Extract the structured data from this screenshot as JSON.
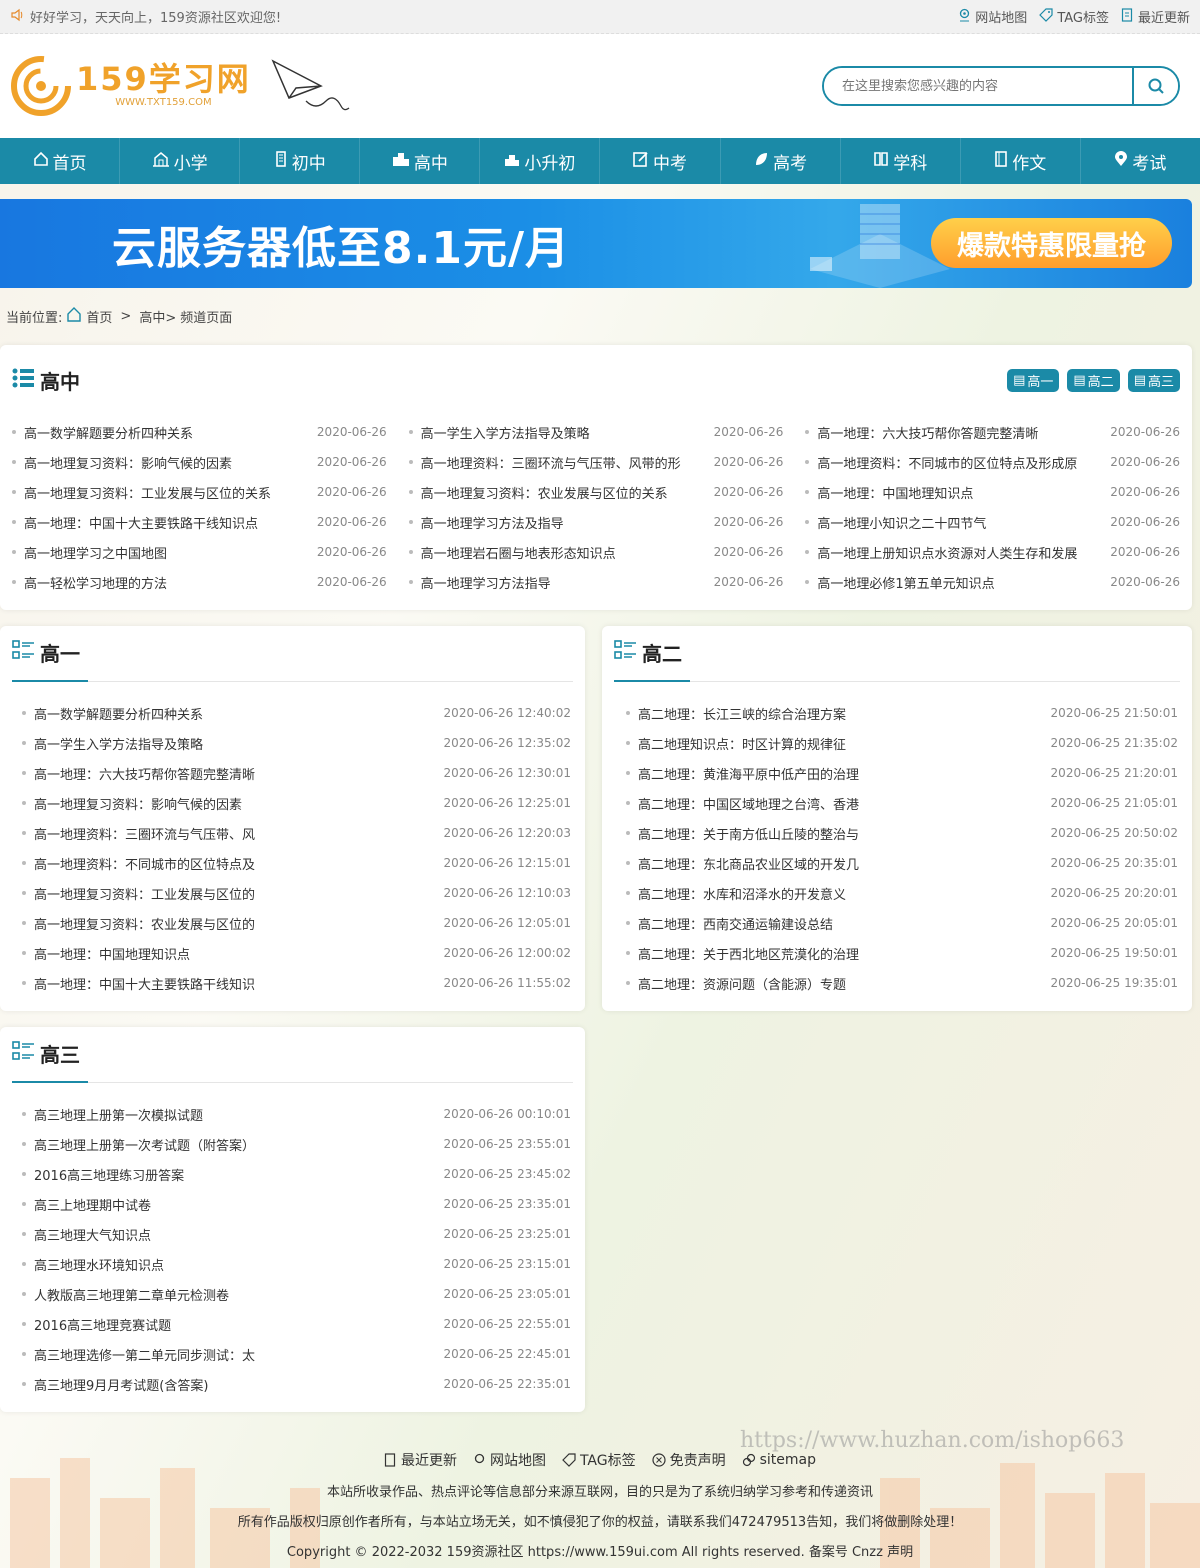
{
  "topbar": {
    "welcome": "好好学习，天天向上，159资源社区欢迎您!",
    "links": [
      "网站地图",
      "TAG标签",
      "最近更新"
    ]
  },
  "header": {
    "logo_title": "159学习网",
    "logo_url": "WWW.TXT159.COM",
    "search_placeholder": "在这里搜索您感兴趣的内容"
  },
  "nav": [
    "首页",
    "小学",
    "初中",
    "高中",
    "小升初",
    "中考",
    "高考",
    "学科",
    "作文",
    "考试"
  ],
  "banner": {
    "title": "云服务器低至8.1元/月",
    "button": "爆款特惠限量抢"
  },
  "breadcrumb": {
    "prefix": "当前位置:",
    "home": "首页",
    "sep": ">",
    "current": "高中>",
    "page": "频道页面"
  },
  "main_card": {
    "title": "高中",
    "tabs": [
      "高一",
      "高二",
      "高三"
    ],
    "columns": [
      [
        {
          "title": "高一数学解题要分析四种关系",
          "date": "2020-06-26"
        },
        {
          "title": "高一地理复习资料：影响气候的因素",
          "date": "2020-06-26"
        },
        {
          "title": "高一地理复习资料：工业发展与区位的关系",
          "date": "2020-06-26"
        },
        {
          "title": "高一地理：中国十大主要铁路干线知识点",
          "date": "2020-06-26"
        },
        {
          "title": "高一地理学习之中国地图",
          "date": "2020-06-26"
        },
        {
          "title": "高一轻松学习地理的方法",
          "date": "2020-06-26"
        }
      ],
      [
        {
          "title": "高一学生入学方法指导及策略",
          "date": "2020-06-26"
        },
        {
          "title": "高一地理资料：三圈环流与气压带、风带的形",
          "date": "2020-06-26"
        },
        {
          "title": "高一地理复习资料：农业发展与区位的关系",
          "date": "2020-06-26"
        },
        {
          "title": "高一地理学习方法及指导",
          "date": "2020-06-26"
        },
        {
          "title": "高一地理岩石圈与地表形态知识点",
          "date": "2020-06-26"
        },
        {
          "title": "高一地理学习方法指导",
          "date": "2020-06-26"
        }
      ],
      [
        {
          "title": "高一地理：六大技巧帮你答题完整清晰",
          "date": "2020-06-26"
        },
        {
          "title": "高一地理资料：不同城市的区位特点及形成原",
          "date": "2020-06-26"
        },
        {
          "title": "高一地理：中国地理知识点",
          "date": "2020-06-26"
        },
        {
          "title": "高一地理小知识之二十四节气",
          "date": "2020-06-26"
        },
        {
          "title": "高一地理上册知识点水资源对人类生存和发展",
          "date": "2020-06-26"
        },
        {
          "title": "高一地理必修1第五单元知识点",
          "date": "2020-06-26"
        }
      ]
    ]
  },
  "gaoyi": {
    "title": "高一",
    "items": [
      {
        "title": "高一数学解题要分析四种关系",
        "date": "2020-06-26 12:40:02"
      },
      {
        "title": "高一学生入学方法指导及策略",
        "date": "2020-06-26 12:35:02"
      },
      {
        "title": "高一地理：六大技巧帮你答题完整清晰",
        "date": "2020-06-26 12:30:01"
      },
      {
        "title": "高一地理复习资料：影响气候的因素",
        "date": "2020-06-26 12:25:01"
      },
      {
        "title": "高一地理资料：三圈环流与气压带、风",
        "date": "2020-06-26 12:20:03"
      },
      {
        "title": "高一地理资料：不同城市的区位特点及",
        "date": "2020-06-26 12:15:01"
      },
      {
        "title": "高一地理复习资料：工业发展与区位的",
        "date": "2020-06-26 12:10:03"
      },
      {
        "title": "高一地理复习资料：农业发展与区位的",
        "date": "2020-06-26 12:05:01"
      },
      {
        "title": "高一地理：中国地理知识点",
        "date": "2020-06-26 12:00:02"
      },
      {
        "title": "高一地理：中国十大主要铁路干线知识",
        "date": "2020-06-26 11:55:02"
      }
    ]
  },
  "gaoer": {
    "title": "高二",
    "items": [
      {
        "title": "高二地理：长江三峡的综合治理方案",
        "date": "2020-06-25 21:50:01"
      },
      {
        "title": "高二地理知识点：时区计算的规律征",
        "date": "2020-06-25 21:35:02"
      },
      {
        "title": "高二地理：黄淮海平原中低产田的治理",
        "date": "2020-06-25 21:20:01"
      },
      {
        "title": "高二地理：中国区域地理之台湾、香港",
        "date": "2020-06-25 21:05:01"
      },
      {
        "title": "高二地理：关于南方低山丘陵的整治与",
        "date": "2020-06-25 20:50:02"
      },
      {
        "title": "高二地理：东北商品农业区域的开发几",
        "date": "2020-06-25 20:35:01"
      },
      {
        "title": "高二地理：水库和沼泽水的开发意义",
        "date": "2020-06-25 20:20:01"
      },
      {
        "title": "高二地理：西南交通运输建设总结",
        "date": "2020-06-25 20:05:01"
      },
      {
        "title": "高二地理：关于西北地区荒漠化的治理",
        "date": "2020-06-25 19:50:01"
      },
      {
        "title": "高二地理：资源问题（含能源）专题",
        "date": "2020-06-25 19:35:01"
      }
    ]
  },
  "gaosan": {
    "title": "高三",
    "items": [
      {
        "title": "高三地理上册第一次模拟试题",
        "date": "2020-06-26 00:10:01"
      },
      {
        "title": "高三地理上册第一次考试题（附答案）",
        "date": "2020-06-25 23:55:01"
      },
      {
        "title": "2016高三地理练习册答案",
        "date": "2020-06-25 23:45:02"
      },
      {
        "title": "高三上地理期中试卷",
        "date": "2020-06-25 23:35:01"
      },
      {
        "title": "高三地理大气知识点",
        "date": "2020-06-25 23:25:01"
      },
      {
        "title": "高三地理水环境知识点",
        "date": "2020-06-25 23:15:01"
      },
      {
        "title": "人教版高三地理第二章单元检测卷",
        "date": "2020-06-25 23:05:01"
      },
      {
        "title": "2016高三地理竞赛试题",
        "date": "2020-06-25 22:55:01"
      },
      {
        "title": "高三地理选修一第二单元同步测试：太",
        "date": "2020-06-25 22:45:01"
      },
      {
        "title": "高三地理9月月考试题(含答案)",
        "date": "2020-06-25 22:35:01"
      }
    ]
  },
  "footer": {
    "links": [
      "最近更新",
      "网站地图",
      "TAG标签",
      "免责声明",
      "sitemap"
    ],
    "line1": "本站所收录作品、热点评论等信息部分来源互联网，目的只是为了系统归纳学习参考和传递资讯",
    "line2": "所有作品版权归原创作者所有，与本站立场无关，如不慎侵犯了你的权益，请联系我们472479513告知，我们将做删除处理！",
    "line3": "Copyright © 2022-2032 159资源社区 https://www.159ui.com All rights reserved. 备案号 Cnzz 声明"
  },
  "watermark": "https://www.huzhan.com/ishop663",
  "colors": {
    "primary": "#1b8aa7",
    "logo": "#f0a22a"
  }
}
